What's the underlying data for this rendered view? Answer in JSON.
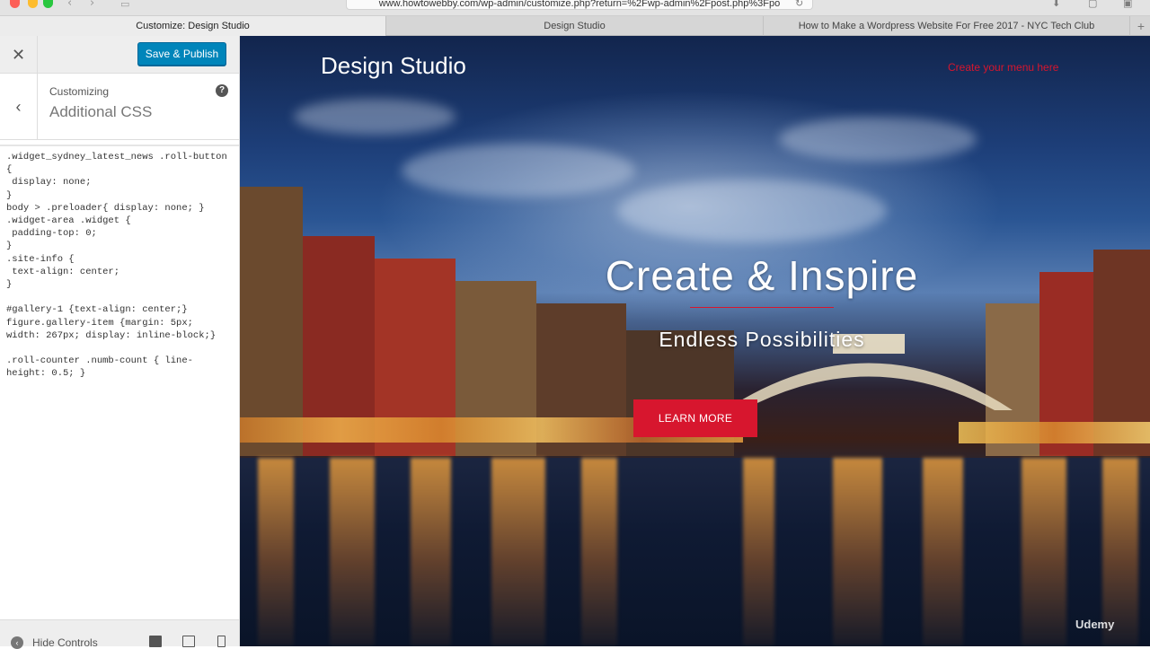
{
  "browser": {
    "url": "www.howtowebby.com/wp-admin/customize.php?return=%2Fwp-admin%2Fpost.php%3Fpo",
    "tabs": [
      {
        "label": "Customize: Design Studio",
        "active": true
      },
      {
        "label": "Design Studio",
        "active": false
      },
      {
        "label": "How to Make a Wordpress Website For Free 2017 - NYC Tech Club",
        "active": false
      }
    ]
  },
  "customizer": {
    "save_label": "Save & Publish",
    "breadcrumb": "Customizing",
    "section_title": "Additional CSS",
    "css_code": ".widget_sydney_latest_news .roll-button\n{\n display: none;\n}\nbody > .preloader{ display: none; }\n.widget-area .widget {\n padding-top: 0;\n}\n.site-info {\n text-align: center;\n}\n\n#gallery-1 {text-align: center;}\nfigure.gallery-item {margin: 5px;\nwidth: 267px; display: inline-block;}\n\n.roll-counter .numb-count { line-\nheight: 0.5; }",
    "footer_label": "Hide Controls"
  },
  "preview": {
    "site_title": "Design Studio",
    "menu_placeholder": "Create your menu here",
    "hero_title": "Create & Inspire",
    "hero_subtitle": "Endless Possibilities",
    "cta_label": "LEARN MORE",
    "watermark": "Udemy",
    "accent": "#d7162e"
  }
}
